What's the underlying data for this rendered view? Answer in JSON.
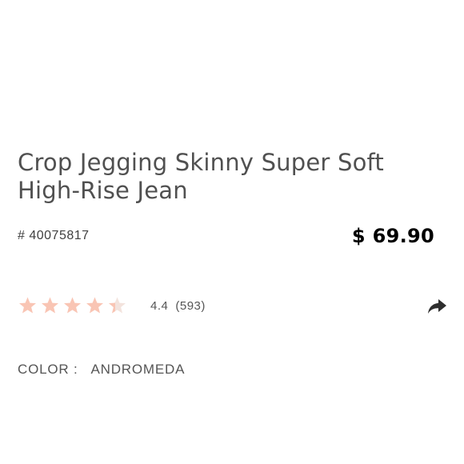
{
  "product": {
    "title_line1": "Crop Jegging Skinny Super Soft",
    "title_line2": "High-Rise Jean",
    "sku": "# 40075817",
    "price": "$ 69.90",
    "rating": {
      "value": "4.4",
      "count": "(593)",
      "score": 4.4,
      "max": 5,
      "star_color": "#f9c5b4",
      "star_empty_color": "#f3e3dd"
    },
    "color": {
      "label": "COLOR :",
      "value": "ANDROMEDA"
    }
  },
  "icons": {
    "share": "share-arrow-icon",
    "star": "star-icon"
  }
}
